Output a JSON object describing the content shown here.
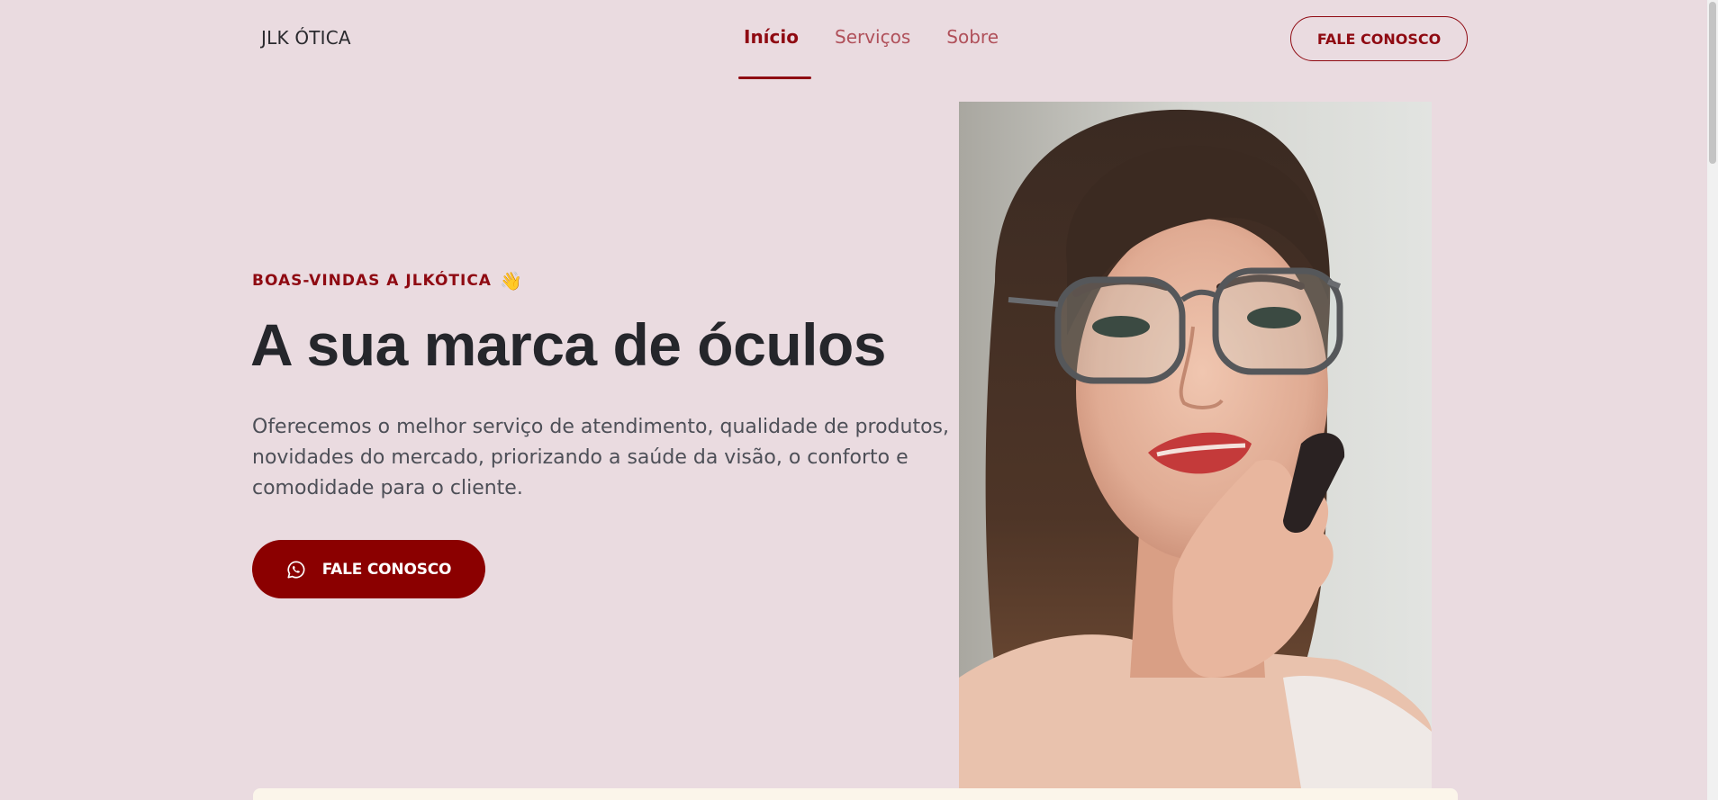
{
  "header": {
    "brand": "JLK ÓTICA",
    "nav": [
      {
        "label": "Início",
        "active": true
      },
      {
        "label": "Serviços",
        "active": false
      },
      {
        "label": "Sobre",
        "active": false
      }
    ],
    "cta_label": "FALE CONOSCO"
  },
  "hero": {
    "eyebrow": "BOAS-VINDAS A JLKÓTICA",
    "eyebrow_icon": "waving-hand-icon",
    "headline": "A sua marca de óculos",
    "description_lines": [
      "Oferecemos o melhor serviço de atendimento, qualidade de produtos,",
      "novidades do mercado, priorizando a saúde da visão, o conforto e",
      "comodidade para o cliente."
    ],
    "cta_label": "FALE CONOSCO",
    "cta_icon": "whatsapp-icon"
  },
  "photo": {
    "icon": "woman-with-glasses-photo"
  },
  "colors": {
    "background": "#eadbe0",
    "accent": "#8b0000",
    "accent_text": "#8f0a12",
    "nav_inactive": "#b0505a",
    "headline": "#25262b",
    "body_text": "#4d4f57",
    "strip": "#fbf5ea"
  }
}
